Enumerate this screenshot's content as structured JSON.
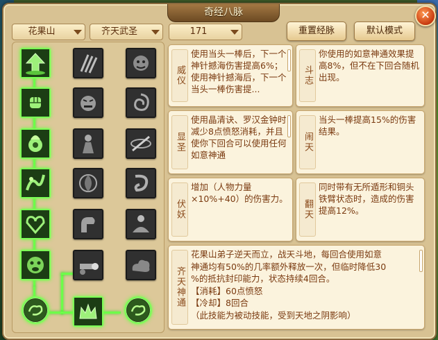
{
  "window": {
    "title": "奇经八脉"
  },
  "dropdowns": [
    {
      "id": "sect",
      "value": "花果山"
    },
    {
      "id": "school",
      "value": "齐天武圣"
    },
    {
      "id": "level",
      "value": "171"
    }
  ],
  "buttons": {
    "reset": "重置经脉",
    "default_mode": "默认模式",
    "close": "✕"
  },
  "meridians": [
    {
      "name": "威仪",
      "desc": "使用当头一棒后，下一个神针撼海伤害提高6%；使用神针撼海后，下一个当头一棒伤害提..."
    },
    {
      "name": "斗志",
      "desc": "你使用的如意神通效果提高8%，但不在下回合随机出现。"
    },
    {
      "name": "显圣",
      "desc": "使用晶清诀、罗汉金钟时减少8点愤怒消耗，并且使你下回合可以使用任何如意神通"
    },
    {
      "name": "闹天",
      "desc": "当头一棒提高15%的伤害结果。"
    },
    {
      "name": "伏妖",
      "desc": "增加（人物力量×10%+40）的伤害力。"
    },
    {
      "name": "翻天",
      "desc": "同时带有无所遁形和铜头铁臂状态时，造成的伤害提高12%。"
    }
  ],
  "ultimate": {
    "name": "齐天神通",
    "desc_lines": [
      "花果山弟子逆天而立，战天斗地，每回合使用如意",
      "神通均有50%的几率额外释放一次，但临时降低30",
      "%的抵抗封印能力，状态持续4回合。",
      "【消耗】60点愤怒",
      "【冷却】8回合",
      "（此技能为被动技能，受到天地之阴影响）"
    ]
  },
  "grid": {
    "rows": [
      [
        "arrow-up-icon",
        "claw-slash-icon",
        "monkey-face-icon"
      ],
      [
        "fist-icon",
        "rage-face-icon",
        "spiral-ear-icon"
      ],
      [
        "flame-head-icon",
        "shadow-figure-icon",
        "staff-spin-icon"
      ],
      [
        "fire-swirl-icon",
        "vortex-icon",
        "dragon-coil-icon"
      ],
      [
        "heart-knot-icon",
        "flex-arm-icon",
        "seated-monk-icon"
      ],
      [
        "monkey-roar-icon",
        "cannon-strike-icon",
        "dark-cloud-icon"
      ]
    ],
    "bottom": [
      "cloud-seal-left-icon",
      "golden-crown-icon",
      "cloud-seal-right-icon"
    ],
    "active_path": "left-column"
  },
  "colors": {
    "accent_green": "#6dff4a",
    "title_bg": "#8a6234",
    "text_brown": "#7a3a10"
  }
}
